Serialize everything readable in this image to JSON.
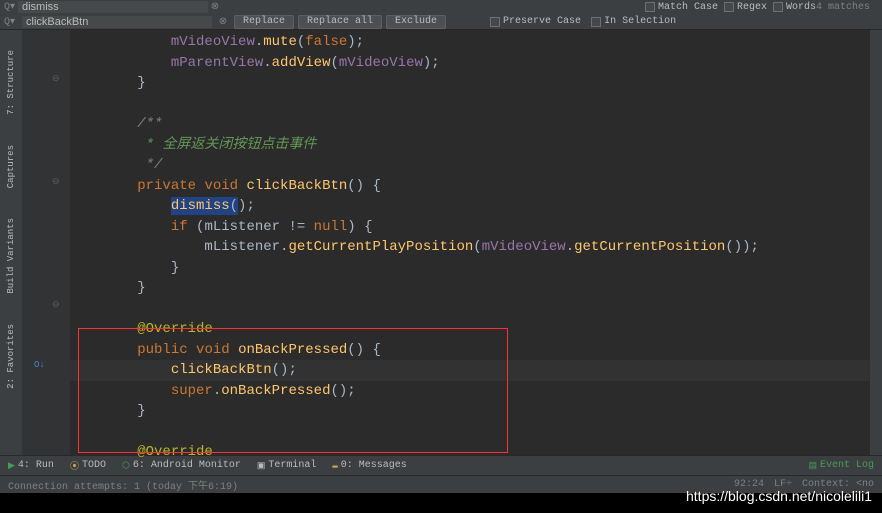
{
  "search": {
    "find_icon": "Q▾",
    "find_value": "dismiss",
    "replace_icon": "Q▾",
    "replace_value": "clickBackBtn",
    "btn_replace": "Replace",
    "btn_replace_all": "Replace all",
    "btn_exclude": "Exclude",
    "cb_match_case": "Match Case",
    "cb_regex": "Regex",
    "cb_words": "Words",
    "cb_preserve": "Preserve Case",
    "cb_in_selection": "In Selection",
    "matches": "4 matches"
  },
  "sidebar": {
    "structure": "7: Structure",
    "captures": "Captures",
    "build_variants": "Build Variants",
    "favorites": "2: Favorites"
  },
  "code": {
    "l1": "            mVideoView.mute(false);",
    "l2": "            mParentView.addView(mVideoView);",
    "l3": "        }",
    "l4": "",
    "l5": "        /**",
    "l6": "         * 全屏返关闭按钮点击事件",
    "l7": "         */",
    "l8_pre": "        ",
    "l8_kw1": "private",
    "l8_sp1": " ",
    "l8_kw2": "void",
    "l8_sp2": " ",
    "l8_method": "clickBackBtn",
    "l8_post": "() {",
    "l9_pre": "            ",
    "l9_call": "dismiss(",
    "l9_cursor": ")",
    "l9_post": ";",
    "l10_pre": "            ",
    "l10_kw": "if",
    "l10_mid": " (mListener != ",
    "l10_null": "null",
    "l10_post": ") {",
    "l11_pre": "                mListener.",
    "l11_m1": "getCurrentPlayPosition",
    "l11_mid": "(",
    "l11_p1": "mVideoView",
    "l11_dot": ".",
    "l11_m2": "getCurrentPosition",
    "l11_post": "());",
    "l12": "            }",
    "l13": "        }",
    "l14": "",
    "l15_pre": "        ",
    "l15_ov": "@Override",
    "l16_pre": "        ",
    "l16_kw1": "public",
    "l16_sp": " ",
    "l16_kw2": "void",
    "l16_sp2": " ",
    "l16_method": "onBackPressed",
    "l16_post": "() {",
    "l17_pre": "            ",
    "l17_call": "clickBackBtn()",
    "l17_post": ";",
    "l18_pre": "            ",
    "l18_kw": "super",
    "l18_dot": ".",
    "l18_m": "onBackPressed",
    "l18_post": "();",
    "l19": "        }",
    "l20": "",
    "l21_pre": "        ",
    "l21_ov": "@Override"
  },
  "toolbar": {
    "run": "4: Run",
    "todo": "TODO",
    "android": "6: Android Monitor",
    "terminal": "Terminal",
    "messages": "0: Messages",
    "event_log": "Event Log"
  },
  "status": {
    "left": "Connection attempts: 1 (today 下午6:19)",
    "pos": "92:24",
    "lf": "LF÷",
    "context": "Context: <no"
  },
  "watermark": "https://blog.csdn.net/nicolelili1"
}
